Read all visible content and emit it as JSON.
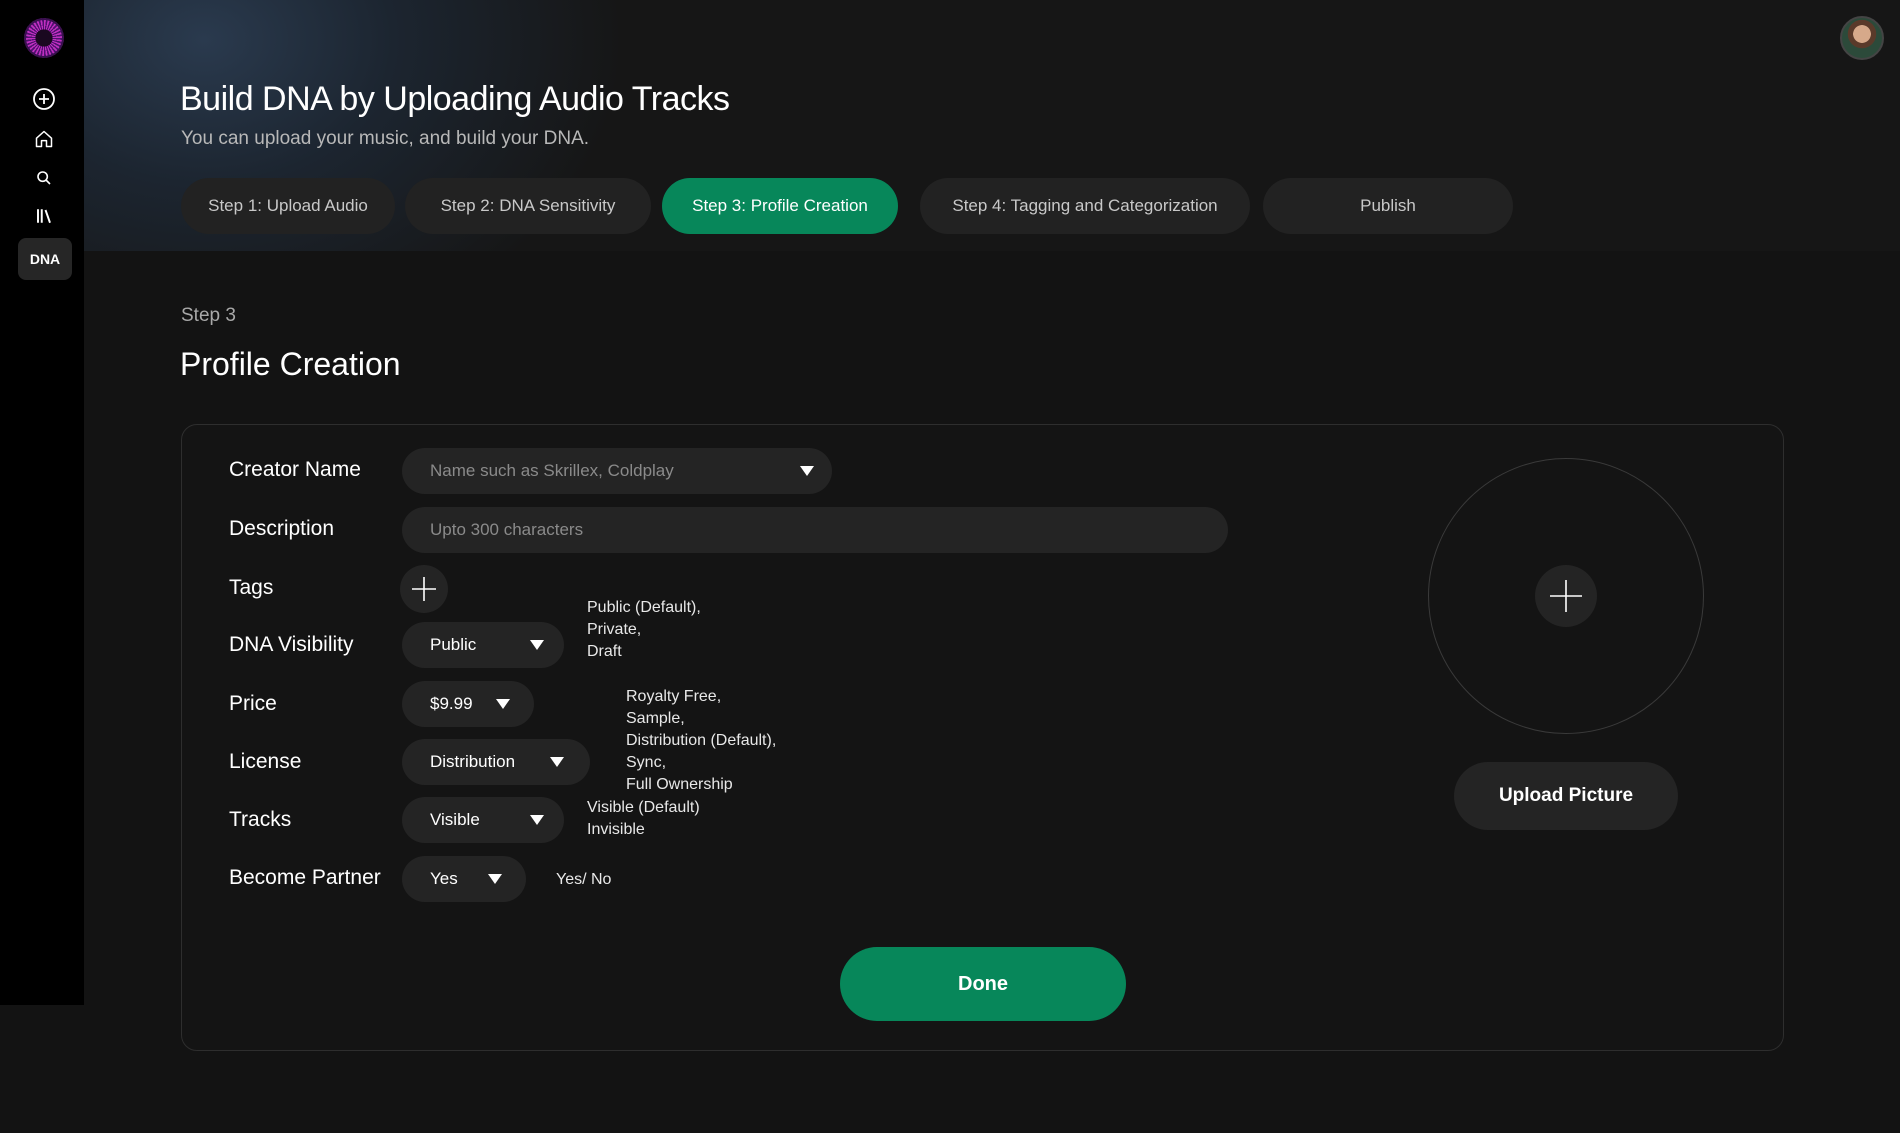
{
  "page": {
    "title": "Build DNA by Uploading Audio Tracks",
    "subtitle": "You can upload your music, and build your DNA."
  },
  "sidebar": {
    "dna_label": "DNA",
    "icons": [
      "logo",
      "add-icon",
      "home-icon",
      "search-icon",
      "library-icon"
    ]
  },
  "steps": [
    {
      "label": "Step 1: Upload Audio",
      "active": false
    },
    {
      "label": "Step 2: DNA Sensitivity",
      "active": false
    },
    {
      "label": "Step 3: Profile Creation",
      "active": true
    },
    {
      "label": "Step 4: Tagging and Categorization",
      "active": false
    },
    {
      "label": "Publish",
      "active": false
    }
  ],
  "section": {
    "step_label": "Step 3",
    "title": "Profile Creation"
  },
  "form": {
    "creator_name": {
      "label": "Creator Name",
      "placeholder": "Name such as Skrillex, Coldplay"
    },
    "description": {
      "label": "Description",
      "placeholder": "Upto 300 characters"
    },
    "tags": {
      "label": "Tags"
    },
    "visibility": {
      "label": "DNA Visibility",
      "value": "Public",
      "options": [
        "Public (Default),",
        "Private,",
        "Draft"
      ]
    },
    "price": {
      "label": "Price",
      "value": "$9.99"
    },
    "license": {
      "label": "License",
      "value": "Distribution",
      "options": [
        "Royalty Free,",
        "Sample,",
        "Distribution (Default),",
        "Sync,",
        "Full Ownership"
      ]
    },
    "tracks": {
      "label": "Tracks",
      "value": "Visible",
      "options": [
        "Visible (Default)",
        "Invisible"
      ]
    },
    "partner": {
      "label": "Become Partner",
      "value": "Yes",
      "note": "Yes/ No"
    }
  },
  "upload_picture_label": "Upload Picture",
  "done_label": "Done",
  "colors": {
    "accent": "#07875a",
    "background": "#131313",
    "pill": "#242424"
  }
}
